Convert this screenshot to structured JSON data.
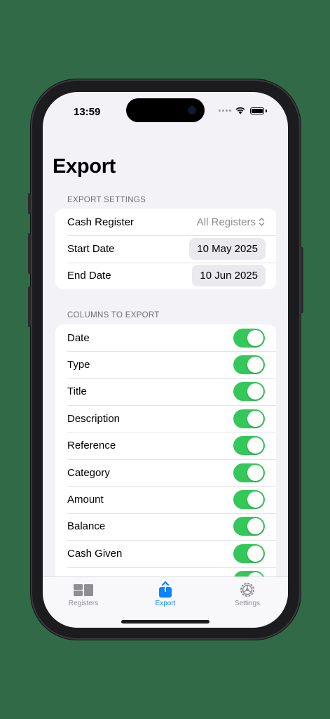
{
  "status_bar": {
    "time": "13:59"
  },
  "page": {
    "title": "Export"
  },
  "export_settings": {
    "header": "EXPORT SETTINGS",
    "cash_register": {
      "label": "Cash Register",
      "value": "All Registers"
    },
    "start_date": {
      "label": "Start Date",
      "value": "10 May 2025"
    },
    "end_date": {
      "label": "End Date",
      "value": "10 Jun 2025"
    }
  },
  "columns": {
    "header": "COLUMNS TO EXPORT",
    "items": [
      {
        "label": "Date",
        "on": true
      },
      {
        "label": "Type",
        "on": true
      },
      {
        "label": "Title",
        "on": true
      },
      {
        "label": "Description",
        "on": true
      },
      {
        "label": "Reference",
        "on": true
      },
      {
        "label": "Category",
        "on": true
      },
      {
        "label": "Amount",
        "on": true
      },
      {
        "label": "Balance",
        "on": true
      },
      {
        "label": "Cash Given",
        "on": true
      }
    ]
  },
  "tab_bar": {
    "tabs": [
      {
        "label": "Registers",
        "icon": "registers-icon",
        "active": false
      },
      {
        "label": "Export",
        "icon": "share-icon",
        "active": true
      },
      {
        "label": "Settings",
        "icon": "gear-icon",
        "active": false
      }
    ]
  },
  "colors": {
    "accent": "#0a84ff",
    "toggle_on": "#34c759",
    "background": "#316a46"
  }
}
